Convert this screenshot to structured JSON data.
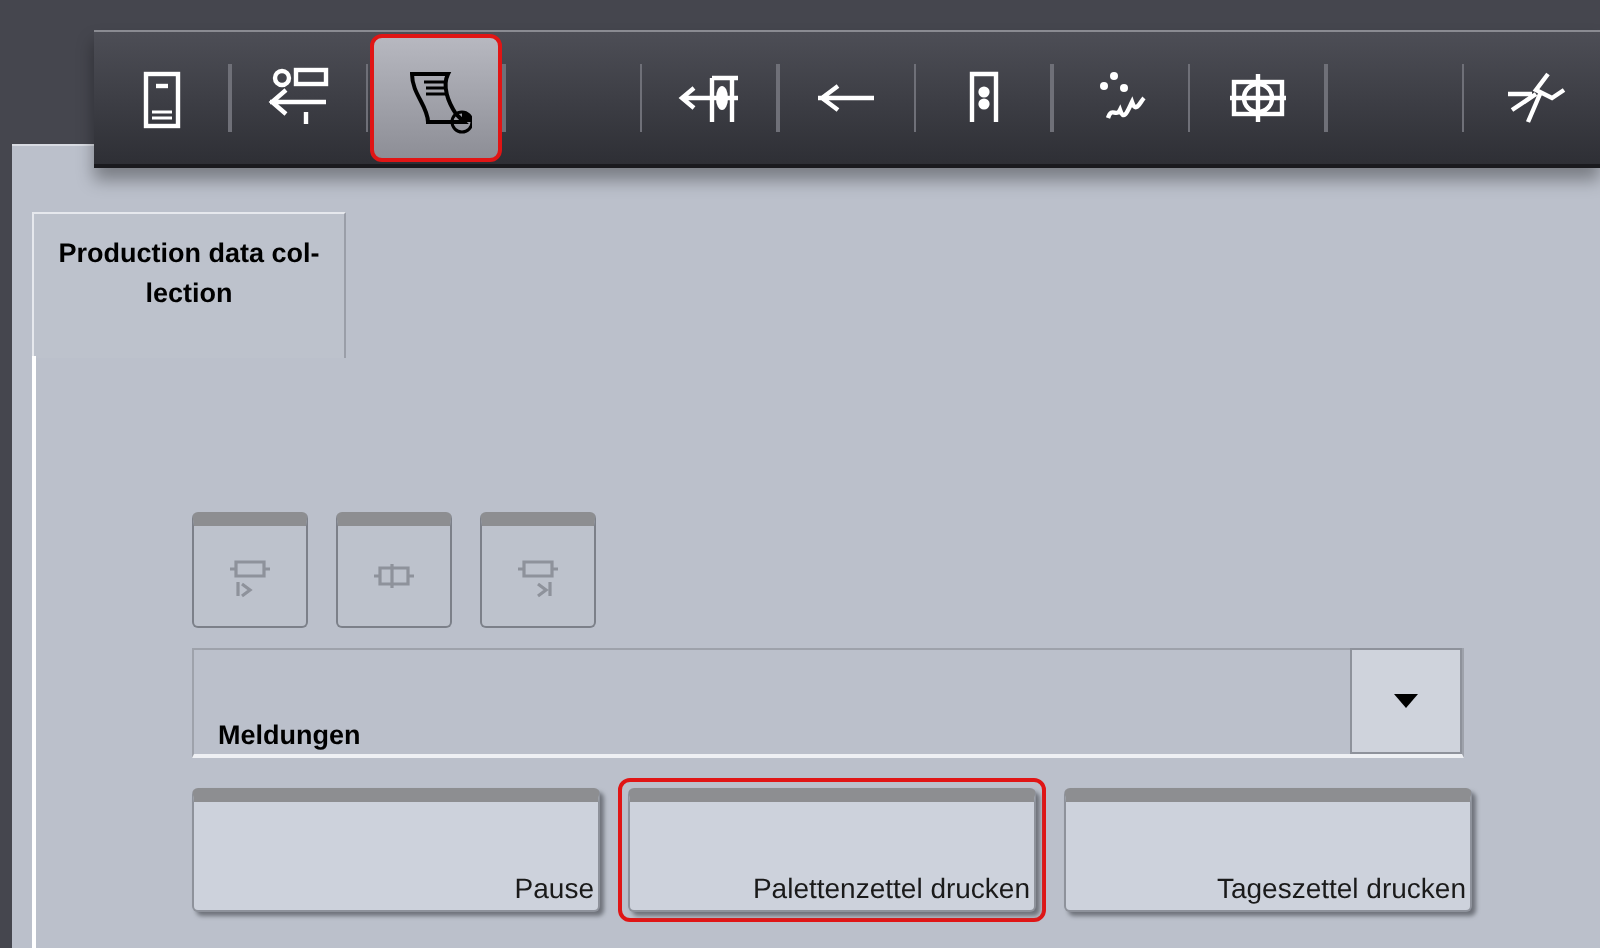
{
  "toolbar": {
    "items": [
      {
        "kind": "tool",
        "selected": false
      },
      {
        "kind": "tool",
        "selected": false
      },
      {
        "kind": "tool",
        "selected": true
      },
      {
        "kind": "blank"
      },
      {
        "kind": "tool",
        "selected": false
      },
      {
        "kind": "tool",
        "selected": false
      },
      {
        "kind": "tool",
        "selected": false
      },
      {
        "kind": "tool",
        "selected": false
      },
      {
        "kind": "tool",
        "selected": false
      },
      {
        "kind": "blank"
      },
      {
        "kind": "tool",
        "selected": false
      }
    ]
  },
  "tabs": [
    {
      "label": "Production data col-lection",
      "selected": true
    }
  ],
  "step_buttons": [
    {
      "disabled": true
    },
    {
      "disabled": true
    },
    {
      "disabled": true
    }
  ],
  "messages": {
    "label": "Meldungen"
  },
  "actions": [
    {
      "label": "Pause",
      "selected": false
    },
    {
      "label": "Palettenzettel drucken",
      "selected": true
    },
    {
      "label": "Tageszettel drucken",
      "selected": false
    }
  ]
}
